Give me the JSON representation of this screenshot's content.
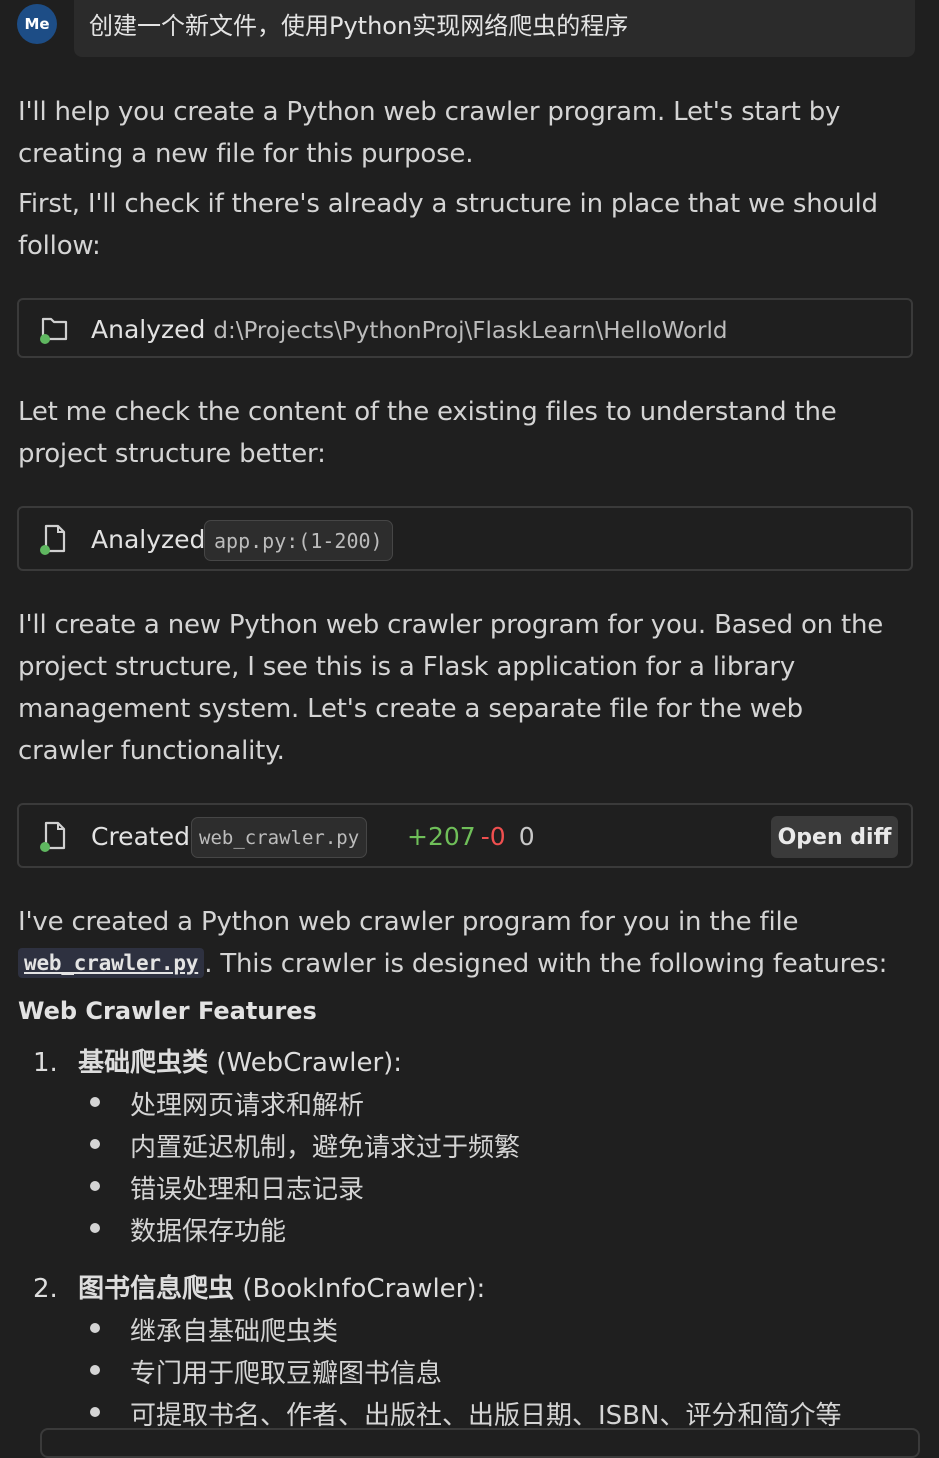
{
  "user": {
    "avatar": "Me",
    "message": "创建一个新文件，使用Python实现网络爬虫的程序"
  },
  "assistant": {
    "para1": "I'll help you create a Python web crawler program. Let's start by creating a new file for this purpose.",
    "para2": "First, I'll check if there's already a structure in place that we should follow:",
    "tool1": {
      "icon": "folder-icon",
      "status_color": "#5fb760",
      "label": "Analyzed",
      "path": "d:\\Projects\\PythonProj\\FlaskLearn\\HelloWorld"
    },
    "para3": "Let me check the content of the existing files to understand the project structure better:",
    "tool2": {
      "icon": "file-icon",
      "label": "Analyzed",
      "file_chip": "app.py:(1-200)"
    },
    "para4": "I'll create a new Python web crawler program for you. Based on the project structure, I see this is a Flask application for a library management system. Let's create a separate file for the web crawler functionality.",
    "tool3": {
      "icon": "file-icon",
      "label": "Created",
      "file_chip": "web_crawler.py",
      "additions": "+207",
      "deletions": "-0",
      "zero": "0",
      "open_diff": "Open diff"
    },
    "para5_prefix": "I've created a Python web crawler program for you in the file",
    "para5_code": "web_crawler.py",
    "para5_suffix": ". This crawler is designed with the following features:",
    "features_heading": "Web Crawler Features",
    "list": [
      {
        "num": "1.",
        "title_cn": "基础爬虫类",
        "title_en": "(WebCrawler):",
        "items": [
          "处理网页请求和解析",
          "内置延迟机制，避免请求过于频繁",
          "错误处理和日志记录",
          "数据保存功能"
        ]
      },
      {
        "num": "2.",
        "title_cn": "图书信息爬虫",
        "title_en": "(BookInfoCrawler):",
        "items": [
          "继承自基础爬虫类",
          "专门用于爬取豆瓣图书信息",
          "可提取书名、作者、出版社、出版日期、ISBN、评分和简介等"
        ]
      }
    ]
  }
}
